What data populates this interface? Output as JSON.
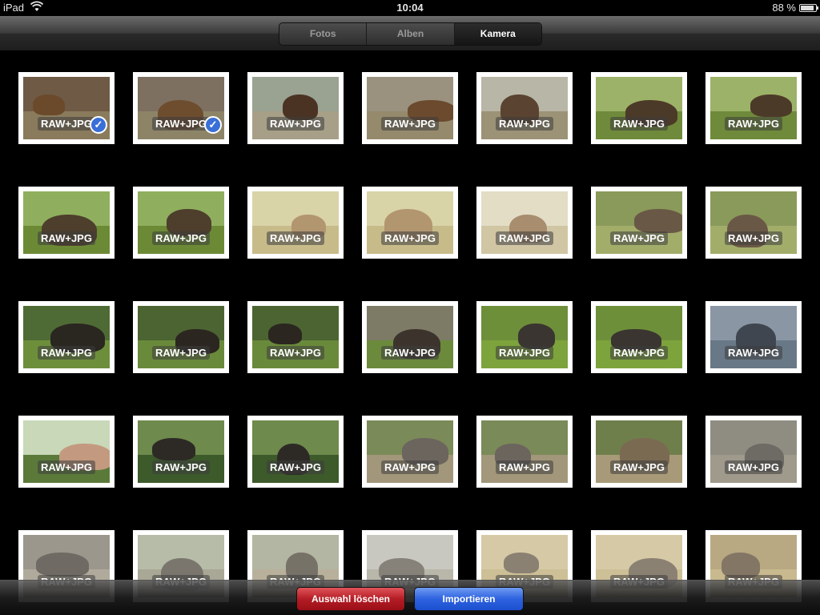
{
  "status_bar": {
    "device": "iPad",
    "time": "10:04",
    "battery": "88 %",
    "battery_level": 0.88
  },
  "tabs": [
    {
      "label": "Fotos",
      "selected": false
    },
    {
      "label": "Alben",
      "selected": false
    },
    {
      "label": "Kamera",
      "selected": true
    }
  ],
  "grid": {
    "columns": 7,
    "badge": "RAW+JPG",
    "items": [
      {
        "badge": "RAW+JPG",
        "selected": true,
        "sky": "#6f5a45",
        "ground": "#8a7b5c",
        "animal": "#6b4a2c"
      },
      {
        "badge": "RAW+JPG",
        "selected": true,
        "sky": "#7d7060",
        "ground": "#8d8468",
        "animal": "#6e4d2f"
      },
      {
        "badge": "RAW+JPG",
        "selected": false,
        "sky": "#9aa292",
        "ground": "#a79f87",
        "animal": "#4a3323"
      },
      {
        "badge": "RAW+JPG",
        "selected": false,
        "sky": "#9a927f",
        "ground": "#958a6c",
        "animal": "#6b4a2e"
      },
      {
        "badge": "RAW+JPG",
        "selected": false,
        "sky": "#b8b6a6",
        "ground": "#9c9276",
        "animal": "#5a4330"
      },
      {
        "badge": "RAW+JPG",
        "selected": false,
        "sky": "#9cb268",
        "ground": "#6f8a3a",
        "animal": "#4c3a28"
      },
      {
        "badge": "RAW+JPG",
        "selected": false,
        "sky": "#9cb268",
        "ground": "#6f8a3a",
        "animal": "#4c3a28"
      },
      {
        "badge": "RAW+JPG",
        "selected": false,
        "sky": "#8faf5e",
        "ground": "#6c8a35",
        "animal": "#4e3e2c"
      },
      {
        "badge": "RAW+JPG",
        "selected": false,
        "sky": "#8faf5e",
        "ground": "#6c8a35",
        "animal": "#4e3e2c"
      },
      {
        "badge": "RAW+JPG",
        "selected": false,
        "sky": "#d9d3a8",
        "ground": "#c8bb8a",
        "animal": "#b29670"
      },
      {
        "badge": "RAW+JPG",
        "selected": false,
        "sky": "#d9d3a8",
        "ground": "#c8bb8a",
        "animal": "#b29670"
      },
      {
        "badge": "RAW+JPG",
        "selected": false,
        "sky": "#e3ddc6",
        "ground": "#d1c6a4",
        "animal": "#a88d6e"
      },
      {
        "badge": "RAW+JPG",
        "selected": false,
        "sky": "#8a9a5a",
        "ground": "#a3ad6a",
        "animal": "#6a5846"
      },
      {
        "badge": "RAW+JPG",
        "selected": false,
        "sky": "#8a9a5a",
        "ground": "#a3ad6a",
        "animal": "#6a5846"
      },
      {
        "badge": "RAW+JPG",
        "selected": false,
        "sky": "#4f6b35",
        "ground": "#6d8f3c",
        "animal": "#2a2620"
      },
      {
        "badge": "RAW+JPG",
        "selected": false,
        "sky": "#4c6432",
        "ground": "#6a8a3b",
        "animal": "#2b2620"
      },
      {
        "badge": "RAW+JPG",
        "selected": false,
        "sky": "#4c6432",
        "ground": "#6a8a3b",
        "animal": "#2b2620"
      },
      {
        "badge": "RAW+JPG",
        "selected": false,
        "sky": "#7d7b66",
        "ground": "#6b8a3c",
        "animal": "#3c342c"
      },
      {
        "badge": "RAW+JPG",
        "selected": false,
        "sky": "#6e8f3a",
        "ground": "#7da33c",
        "animal": "#3a3530"
      },
      {
        "badge": "RAW+JPG",
        "selected": false,
        "sky": "#6e8f3a",
        "ground": "#7da33c",
        "animal": "#3a3530"
      },
      {
        "badge": "RAW+JPG",
        "selected": false,
        "sky": "#8a96a4",
        "ground": "#697887",
        "animal": "#3f4650"
      },
      {
        "badge": "RAW+JPG",
        "selected": false,
        "sky": "#c8d8b8",
        "ground": "#5b7a3a",
        "animal": "#c39a80"
      },
      {
        "badge": "RAW+JPG",
        "selected": false,
        "sky": "#6e8a4c",
        "ground": "#3d5a2a",
        "animal": "#2d2a26"
      },
      {
        "badge": "RAW+JPG",
        "selected": false,
        "sky": "#6e8a4c",
        "ground": "#3d5a2a",
        "animal": "#2d2a26"
      },
      {
        "badge": "RAW+JPG",
        "selected": false,
        "sky": "#7a8a58",
        "ground": "#a2977a",
        "animal": "#6c655e"
      },
      {
        "badge": "RAW+JPG",
        "selected": false,
        "sky": "#7a8a58",
        "ground": "#a2977a",
        "animal": "#6c655e"
      },
      {
        "badge": "RAW+JPG",
        "selected": false,
        "sky": "#6f7f4c",
        "ground": "#a89a78",
        "animal": "#7b6a52"
      },
      {
        "badge": "RAW+JPG",
        "selected": false,
        "sky": "#8f8d82",
        "ground": "#a09a8c",
        "animal": "#6e6a64"
      },
      {
        "badge": "RAW+JPG",
        "selected": false,
        "sky": "#9b978c",
        "ground": "#b0aa9c",
        "animal": "#6f6a63"
      },
      {
        "badge": "RAW+JPG",
        "selected": false,
        "sky": "#b7bca9",
        "ground": "#a9a796",
        "animal": "#7a766d"
      },
      {
        "badge": "RAW+JPG",
        "selected": false,
        "sky": "#b2b6a2",
        "ground": "#b8b09a",
        "animal": "#777268"
      },
      {
        "badge": "RAW+JPG",
        "selected": false,
        "sky": "#c8c8c0",
        "ground": "#b9b6aa",
        "animal": "#86827a"
      },
      {
        "badge": "RAW+JPG",
        "selected": false,
        "sky": "#d6c9a6",
        "ground": "#cdbf96",
        "animal": "#8b8172"
      },
      {
        "badge": "RAW+JPG",
        "selected": false,
        "sky": "#d6c9a6",
        "ground": "#cdbf96",
        "animal": "#8b8172"
      },
      {
        "badge": "RAW+JPG",
        "selected": false,
        "sky": "#b8a982",
        "ground": "#c9b98e",
        "animal": "#837665"
      }
    ]
  },
  "bottom_bar": {
    "delete_label": "Auswahl löschen",
    "import_label": "Importieren"
  }
}
